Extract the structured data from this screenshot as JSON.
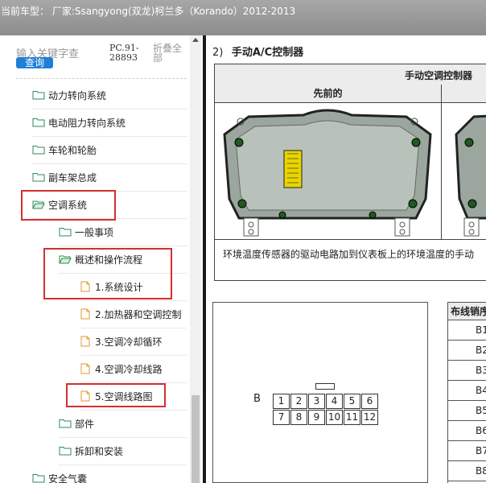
{
  "header": {
    "title": "当前车型： 厂家:Ssangyong(双龙)柯兰多（Korando）2012-2013"
  },
  "left_panel": {
    "search_placeholder": "输入关键字查",
    "search_button": "查询",
    "pc_code": "PC.91-28893",
    "collapse_all": "折叠全部",
    "tree": [
      {
        "label": "动力转向系统",
        "type": "folder",
        "level": 0
      },
      {
        "label": "电动阻力转向系统",
        "type": "folder",
        "level": 0
      },
      {
        "label": "车轮和轮胎",
        "type": "folder",
        "level": 0
      },
      {
        "label": "副车架总成",
        "type": "folder",
        "level": 0
      },
      {
        "label": "空调系统",
        "type": "folder-open",
        "level": 0,
        "highlighted": true
      },
      {
        "label": "一般事项",
        "type": "folder",
        "level": 1
      },
      {
        "label": "概述和操作流程",
        "type": "folder-open",
        "level": 1
      },
      {
        "label": "1.系统设计",
        "type": "doc",
        "level": 2
      },
      {
        "label": "2.加热器和空调控制",
        "type": "doc",
        "level": 2
      },
      {
        "label": "3.空调冷却循环",
        "type": "doc",
        "level": 2
      },
      {
        "label": "4.空调冷却线路",
        "type": "doc",
        "level": 2
      },
      {
        "label": "5.空调线路图",
        "type": "doc",
        "level": 2,
        "highlighted": true
      },
      {
        "label": "部件",
        "type": "folder",
        "level": 1
      },
      {
        "label": "拆卸和安装",
        "type": "folder",
        "level": 1
      },
      {
        "label": "安全气囊",
        "type": "folder",
        "level": 0
      }
    ]
  },
  "content": {
    "section_number": "2)",
    "section_title": "手动A/C控制器",
    "table_header": "手动空调控制器",
    "column_previous": "先前的",
    "description": "环境温度传感器的驱动电路加到仪表板上的环境温度的手动",
    "connector_label": "B",
    "connector_pins_top": [
      "1",
      "2",
      "3",
      "4",
      "5",
      "6"
    ],
    "connector_pins_bottom": [
      "7",
      "8",
      "9",
      "10",
      "11",
      "12"
    ],
    "pin_table_header": "布线销序",
    "pin_rows": [
      "B1",
      "B2",
      "B3",
      "B4",
      "B5",
      "B6",
      "B7",
      "B8"
    ]
  },
  "colors": {
    "highlight": "#d32f2f",
    "folder": "#2e8b57",
    "doc": "#e09a2a",
    "button": "#1f7fd6"
  }
}
